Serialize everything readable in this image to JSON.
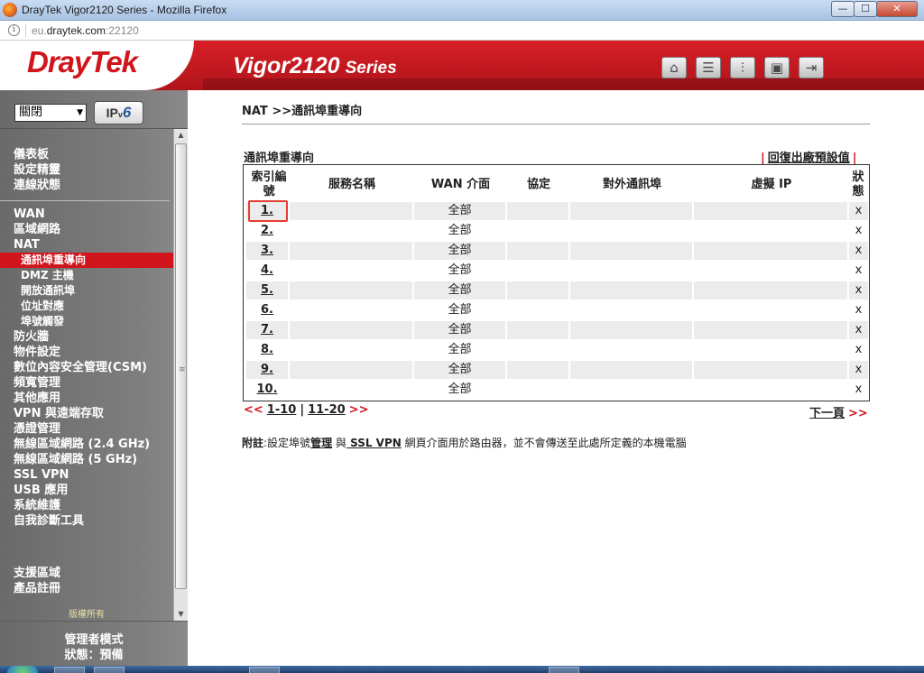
{
  "window": {
    "title": "DrayTek Vigor2120 Series - Mozilla Firefox",
    "min_glyph": "—",
    "max_glyph": "☐",
    "close_glyph": "✕"
  },
  "browser": {
    "url_prefix": "eu.",
    "url_host": "draytek.com",
    "url_suffix": ":22120",
    "info_glyph": "i"
  },
  "header": {
    "logo": "DrayTek",
    "model": "Vigor2120",
    "series": "Series",
    "icons": [
      "home-icon",
      "quick-start-icon",
      "mixer-icon",
      "save-icon",
      "logout-icon"
    ]
  },
  "sidebar": {
    "mode_select": "關閉",
    "ipv6_prefix": "IP",
    "ipv6_v": "v",
    "ipv6_six": "6",
    "group1": [
      "儀表板",
      "設定精靈",
      "連線狀態"
    ],
    "group2": [
      {
        "label": "WAN",
        "sub": false,
        "active": false
      },
      {
        "label": "區域網路",
        "sub": false,
        "active": false
      },
      {
        "label": "NAT",
        "sub": false,
        "active": false
      },
      {
        "label": "通訊埠重導向",
        "sub": true,
        "active": true
      },
      {
        "label": "DMZ 主機",
        "sub": true,
        "active": false
      },
      {
        "label": "開放通訊埠",
        "sub": true,
        "active": false
      },
      {
        "label": "位址對應",
        "sub": true,
        "active": false
      },
      {
        "label": "埠號觸發",
        "sub": true,
        "active": false
      },
      {
        "label": "防火牆",
        "sub": false,
        "active": false
      },
      {
        "label": "物件設定",
        "sub": false,
        "active": false
      },
      {
        "label": "數位內容安全管理(CSM)",
        "sub": false,
        "active": false
      },
      {
        "label": "頻寬管理",
        "sub": false,
        "active": false
      },
      {
        "label": "其他應用",
        "sub": false,
        "active": false
      },
      {
        "label": "VPN 與遠端存取",
        "sub": false,
        "active": false
      },
      {
        "label": "憑證管理",
        "sub": false,
        "active": false
      },
      {
        "label": "無線區域網路 (2.4 GHz)",
        "sub": false,
        "active": false
      },
      {
        "label": "無線區域網路 (5 GHz)",
        "sub": false,
        "active": false
      },
      {
        "label": "SSL VPN",
        "sub": false,
        "active": false
      },
      {
        "label": "USB 應用",
        "sub": false,
        "active": false
      },
      {
        "label": "系統維護",
        "sub": false,
        "active": false
      },
      {
        "label": "自我診斷工具",
        "sub": false,
        "active": false
      }
    ],
    "group3": [
      "支援區域",
      "產品註冊"
    ],
    "copyright": "版權所有",
    "admin_mode": "管理者模式",
    "status": "狀態：預備"
  },
  "main": {
    "breadcrumb": "NAT >>通訊埠重導向",
    "section_title": "通訊埠重導向",
    "restore_bar_l": "|",
    "restore_link": "回復出廠預設值",
    "restore_bar_r": "|",
    "table": {
      "headers": {
        "index": "索引編\n號",
        "service": "服務名稱",
        "wan": "WAN 介面",
        "protocol": "協定",
        "public_port": "對外通訊埠",
        "virtual_ip": "虛擬 IP",
        "status": "狀\n態"
      },
      "rows": [
        {
          "index": "1.",
          "wan": "全部",
          "status": "x"
        },
        {
          "index": "2.",
          "wan": "全部",
          "status": "x"
        },
        {
          "index": "3.",
          "wan": "全部",
          "status": "x"
        },
        {
          "index": "4.",
          "wan": "全部",
          "status": "x"
        },
        {
          "index": "5.",
          "wan": "全部",
          "status": "x"
        },
        {
          "index": "6.",
          "wan": "全部",
          "status": "x"
        },
        {
          "index": "7.",
          "wan": "全部",
          "status": "x"
        },
        {
          "index": "8.",
          "wan": "全部",
          "status": "x"
        },
        {
          "index": "9.",
          "wan": "全部",
          "status": "x"
        },
        {
          "index": "10.",
          "wan": "全部",
          "status": "x"
        }
      ]
    },
    "pager": {
      "prev_arrows": "<<",
      "page1": "1-10",
      "sep": "|",
      "page2": "11-20",
      "next_arrows_l": ">>",
      "next_label": "下一頁",
      "next_arrows_r": ">>"
    },
    "note": {
      "label": "附註",
      "text1": ":設定埠號",
      "link1": "管理",
      "text2": " 與",
      "link2": " SSL VPN",
      "text3": " 網頁介面用於路由器，並不會傳送至此處所定義的本機電腦"
    }
  },
  "colors": {
    "brand_red": "#d0151c",
    "sidebar_gray": "#7d7d7d",
    "row_shade": "#ececec",
    "highlight": "#e53d35"
  }
}
